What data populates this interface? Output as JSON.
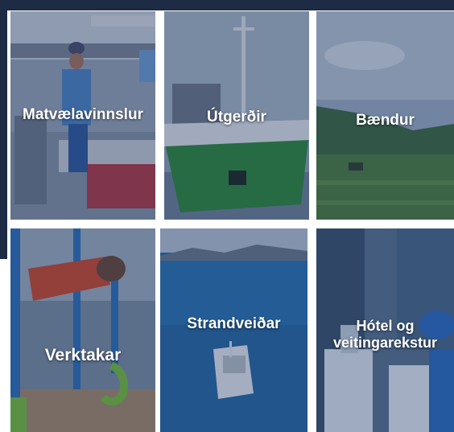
{
  "tiles": [
    {
      "label": "Matvælavinnslur",
      "image": "food-processing-worker-photo"
    },
    {
      "label": "Útgerðir",
      "image": "green-fishing-vessel-photo"
    },
    {
      "label": "Bændur",
      "image": "farm-field-tractor-photo"
    },
    {
      "label": "Verktakar",
      "image": "chains-and-hook-photo"
    },
    {
      "label": "Strandveiðar",
      "image": "small-boat-at-sea-photo"
    },
    {
      "label": "Hótel og veitingarekstur",
      "image": "cleaning-spray-bottles-photo"
    }
  ],
  "colors": {
    "overlay": "#16285a",
    "frame": "#1d2b45",
    "label": "#ffffff"
  }
}
